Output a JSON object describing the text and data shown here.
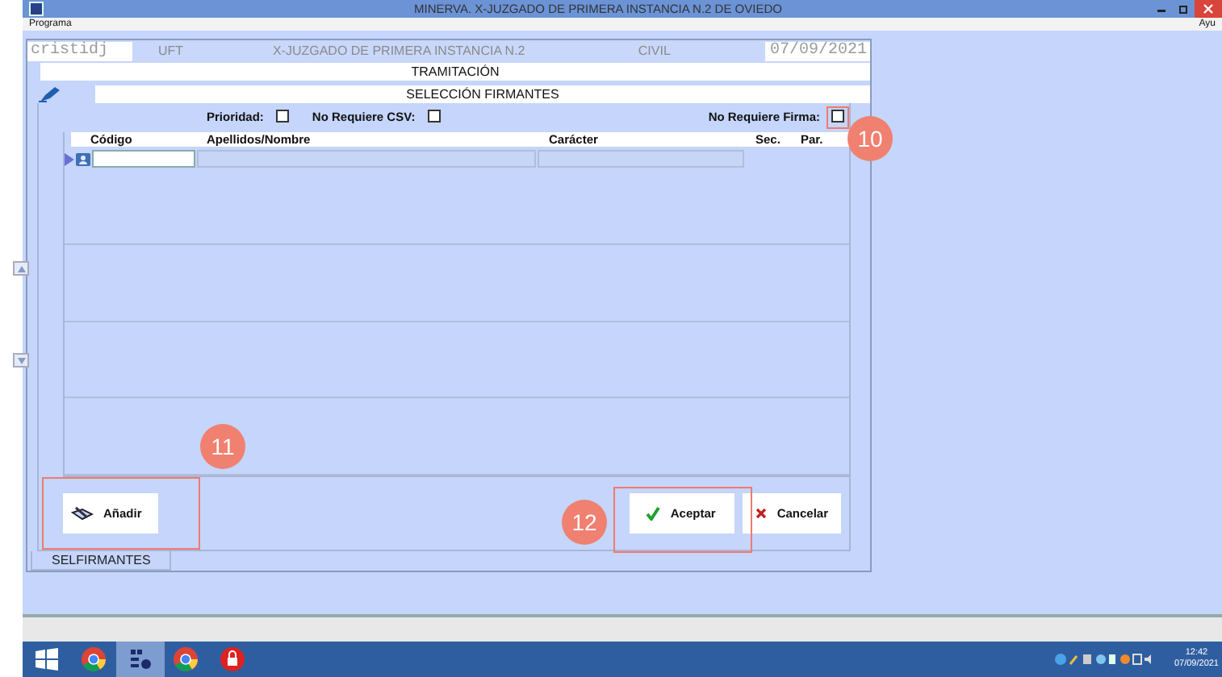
{
  "window": {
    "title": "MINERVA. X-JUZGADO DE PRIMERA INSTANCIA N.2 DE OVIEDO"
  },
  "menu": [
    "Programa",
    "Ayu"
  ],
  "header": {
    "user": "cristidj",
    "unit": "UFT",
    "court": "X-JUZGADO DE PRIMERA INSTANCIA N.2",
    "jurisdiction": "CIVIL",
    "date": "07/09/2021"
  },
  "section": "TRAMITACIÓN",
  "subsection": "SELECCIÓN FIRMANTES",
  "options": [
    {
      "label": "Prioridad:",
      "checked": false
    },
    {
      "label": "No Requiere CSV:",
      "checked": false
    },
    {
      "label": "No Requiere Firma:",
      "checked": false
    }
  ],
  "table": {
    "columns": [
      "Código",
      "Apellidos/Nombre",
      "Carácter",
      "Sec.",
      "Par."
    ]
  },
  "buttons": [
    {
      "label": "Añadir",
      "kind": "add"
    },
    {
      "label": "Aceptar",
      "kind": "accept"
    },
    {
      "label": "Cancelar",
      "kind": "cancel"
    }
  ],
  "tabs": [
    {
      "label": "SELFIRMANTES",
      "selected": true
    }
  ],
  "annotations": [
    {
      "number": "10"
    },
    {
      "number": "11"
    },
    {
      "number": "12"
    }
  ],
  "taskbar": {
    "time": "12:42",
    "date": "07/09/2021"
  }
}
